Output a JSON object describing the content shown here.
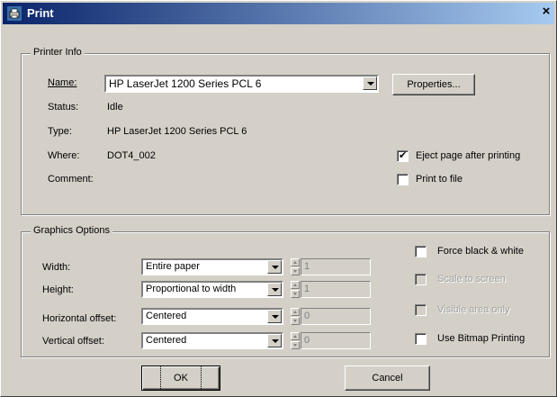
{
  "window": {
    "title": "Print",
    "close_glyph": "×"
  },
  "printer_info": {
    "group_label": "Printer Info",
    "name_label": "Name:",
    "name_value": "HP LaserJet 1200 Series PCL 6",
    "status_label": "Status:",
    "status_value": "Idle",
    "type_label": "Type:",
    "type_value": "HP LaserJet 1200 Series PCL 6",
    "where_label": "Where:",
    "where_value": "DOT4_002",
    "comment_label": "Comment:",
    "properties_button": "Properties...",
    "eject_label": "Eject page after printing",
    "eject_checked": true,
    "print_to_file_label": "Print to file",
    "print_to_file_checked": false
  },
  "graphics": {
    "group_label": "Graphics Options",
    "width_label": "Width:",
    "width_value": "Entire paper",
    "width_number": "1",
    "height_label": "Height:",
    "height_value": "Proportional to width",
    "height_number": "1",
    "h_offset_label": "Horizontal offset:",
    "h_offset_value": "Centered",
    "h_offset_number": "0",
    "v_offset_label": "Vertical offset:",
    "v_offset_value": "Centered",
    "v_offset_number": "0",
    "force_bw_label": "Force black & white",
    "scale_label": "Scale to screen",
    "visible_area_label": "Visible area only",
    "bitmap_label": "Use Bitmap Printing"
  },
  "buttons": {
    "ok": "OK",
    "cancel": "Cancel"
  }
}
